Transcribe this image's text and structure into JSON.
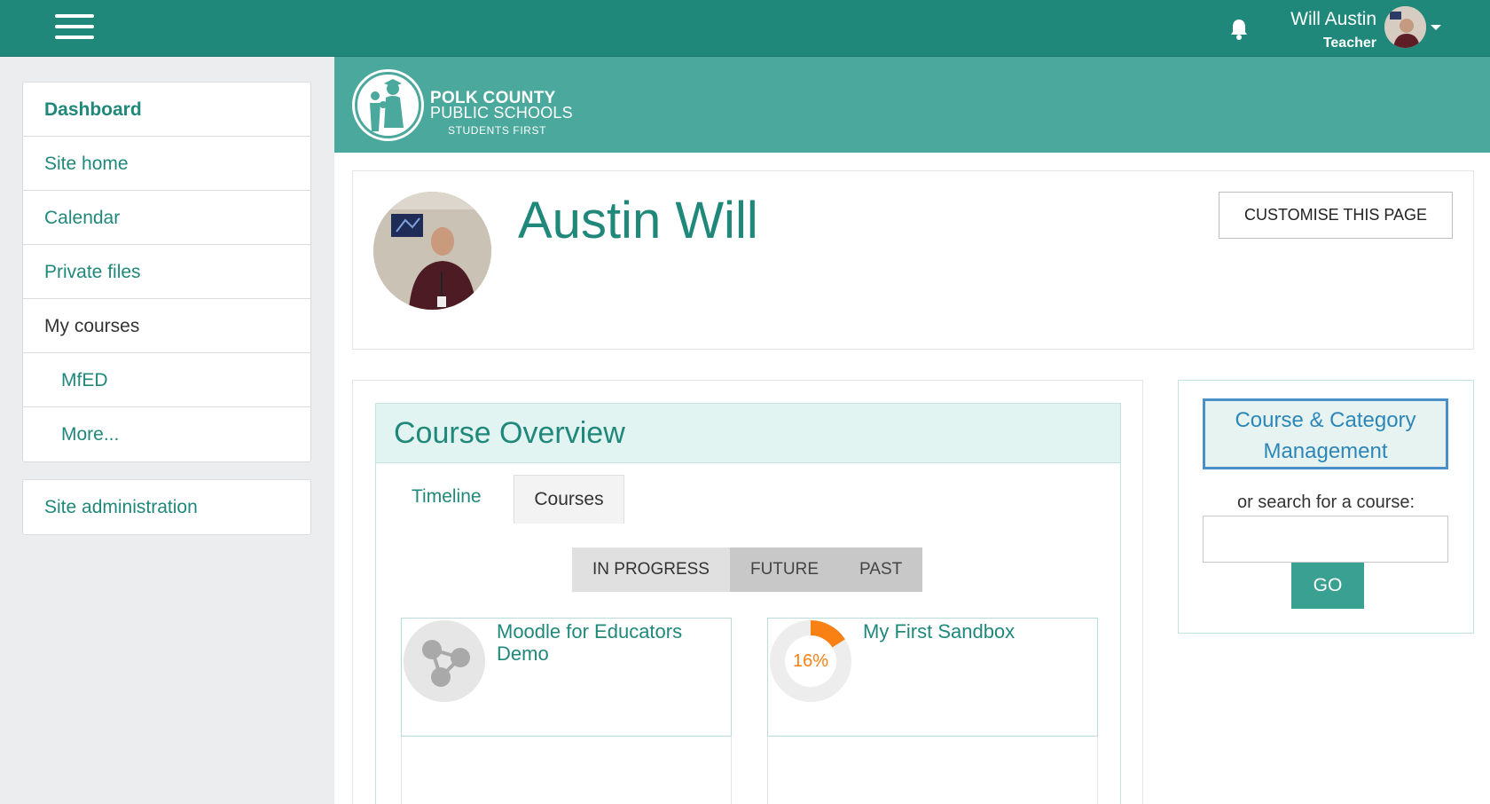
{
  "header": {
    "menu_icon": "hamburger-menu-icon",
    "notification_icon": "bell-icon",
    "user_name": "Will Austin",
    "user_role": "Teacher"
  },
  "sidebar": {
    "items": [
      {
        "label": "Dashboard"
      },
      {
        "label": "Site home"
      },
      {
        "label": "Calendar"
      },
      {
        "label": "Private files"
      },
      {
        "label": "My courses"
      },
      {
        "label": "MfED"
      },
      {
        "label": "More..."
      }
    ],
    "admin_label": "Site administration"
  },
  "banner": {
    "logo_line1": "POLK COUNTY",
    "logo_line2": "PUBLIC SCHOOLS",
    "logo_line3": "STUDENTS FIRST"
  },
  "profile": {
    "name": "Austin Will",
    "customise_label": "CUSTOMISE THIS PAGE"
  },
  "overview": {
    "title": "Course Overview",
    "tabs": {
      "timeline": "Timeline",
      "courses": "Courses"
    },
    "filters": {
      "in_progress": "IN PROGRESS",
      "future": "FUTURE",
      "past": "PAST"
    },
    "courses": [
      {
        "title": "Moodle for Educators Demo",
        "icon": "course-placeholder-icon"
      },
      {
        "title": "My First Sandbox",
        "progress_label": "16%",
        "progress": 0.16
      }
    ]
  },
  "side_block": {
    "management_label": "Course & Category Management",
    "search_label": "or search for a course:",
    "search_value": "",
    "go_label": "GO"
  },
  "colors": {
    "brand": "#1f887a",
    "banner": "#4aa89c",
    "progress": "#f98012",
    "link_blue": "#2d86b8"
  }
}
